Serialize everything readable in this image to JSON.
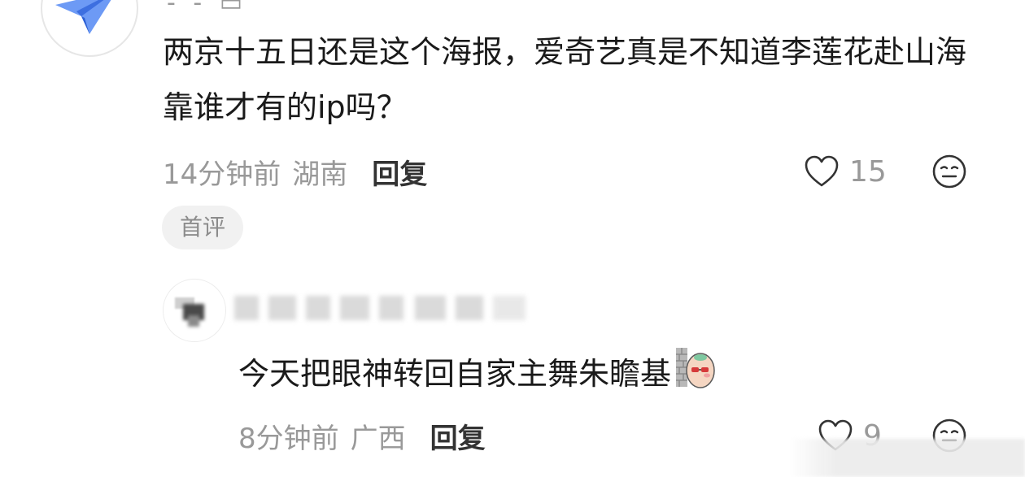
{
  "comment": {
    "author_partial": "- - ▭",
    "text": "两京十五日还是这个海报，爱奇艺真是不知道李莲花赴山海靠谁才有的ip吗？",
    "time": "14分钟前",
    "location": "湖南",
    "reply_label": "回复",
    "likes": "15",
    "badge": "首评"
  },
  "reply": {
    "text": "今天把眼神转回自家主舞朱瞻基",
    "time": "8分钟前",
    "location": "广西",
    "reply_label": "回复",
    "likes": "9"
  },
  "icons": {
    "avatar_top": "paper-plane-icon",
    "like": "heart-outline-icon",
    "emoji": "sleepy-face-icon",
    "sticker": "peeking-egg-sticker"
  },
  "colors": {
    "secondary_text": "#999999",
    "avatar_blue": "#5b8bf0"
  }
}
